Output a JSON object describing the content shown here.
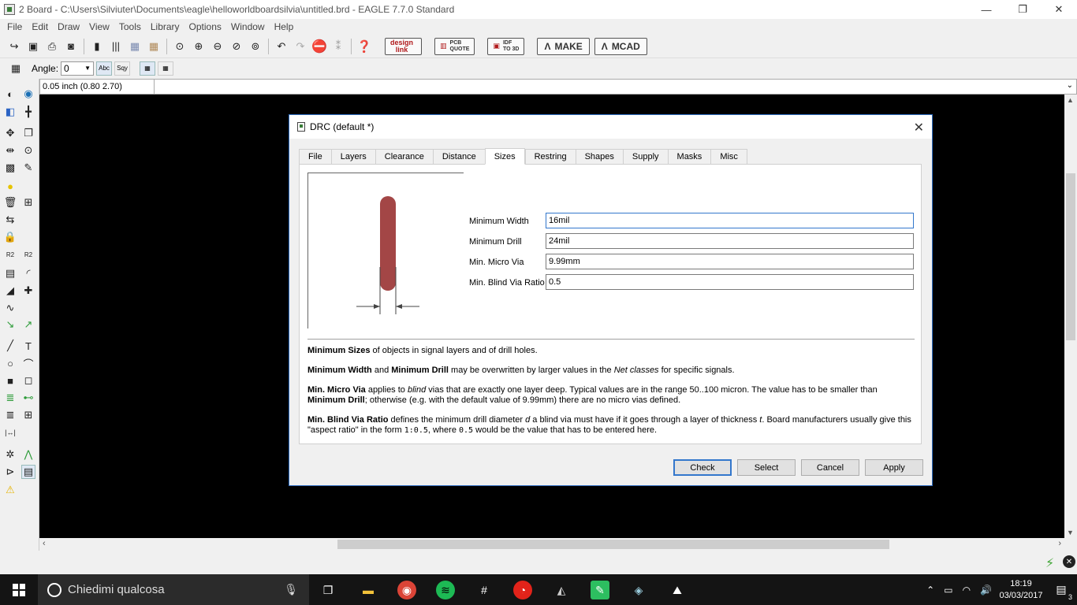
{
  "window": {
    "title": "2 Board - C:\\Users\\Silviuter\\Documents\\eagle\\helloworldboardsilvia\\untitled.brd - EAGLE 7.7.0 Standard",
    "minimize": "—",
    "restore": "❐",
    "close": "✕"
  },
  "menu": [
    "File",
    "Edit",
    "Draw",
    "View",
    "Tools",
    "Library",
    "Options",
    "Window",
    "Help"
  ],
  "toolbar": {
    "designlink_line1": "design",
    "designlink_line2": "link",
    "pcbquote_line1": "PCB",
    "pcbquote_line2": "QUOTE",
    "idf_line1": "IDF",
    "idf_line2": "TO 3D",
    "make_label": "MAKE",
    "mcad_label": "MCAD"
  },
  "toolbar2": {
    "angle_label": "Angle:",
    "angle_value": "0",
    "abc_label": "Abc",
    "sqy_label": "Sqy"
  },
  "command": {
    "coordinates": "0.05 inch (0.80 2.70)"
  },
  "dialog": {
    "title": "DRC (default *)",
    "tabs": [
      "File",
      "Layers",
      "Clearance",
      "Distance",
      "Sizes",
      "Restring",
      "Shapes",
      "Supply",
      "Masks",
      "Misc"
    ],
    "active_tab": "Sizes",
    "fields": {
      "min_width_label": "Minimum Width",
      "min_width_value": "16mil",
      "min_drill_label": "Minimum Drill",
      "min_drill_value": "24mil",
      "micro_via_label": "Min. Micro Via",
      "micro_via_value": "9.99mm",
      "blind_ratio_label": "Min. Blind Via Ratio",
      "blind_ratio_value": "0.5"
    },
    "desc": {
      "p1_b": "Minimum Sizes",
      "p1_t": " of objects in signal layers and of drill holes.",
      "p2_b1": "Minimum Width",
      "p2_t1": " and ",
      "p2_b2": "Minimum Drill",
      "p2_t2": " may be overwritten by larger values in the ",
      "p2_i": "Net classes",
      "p2_t3": " for specific signals.",
      "p3_b1": "Min. Micro Via",
      "p3_t1": " applies to ",
      "p3_i": "blind",
      "p3_t2": " vias that are exactly one layer deep. Typical values are in the range 50..100 micron. The value has to be smaller than ",
      "p3_b2": "Minimum Drill",
      "p3_t3": "; otherwise (e.g. with the default value of 9.99mm) there are no micro vias defined.",
      "p4_b": "Min. Blind Via Ratio",
      "p4_t1": " defines the minimum drill diameter ",
      "p4_i1": "d",
      "p4_t2": " a blind via must have if it goes through a layer of thickness ",
      "p4_i2": "t",
      "p4_t3": ". Board manufacturers usually give this \"aspect ratio\" in the form ",
      "p4_m1": "1:0.5",
      "p4_t4": ", where ",
      "p4_m2": "0.5",
      "p4_t5": " would be the value that has to be entered here."
    },
    "buttons": {
      "check": "Check",
      "select": "Select",
      "cancel": "Cancel",
      "apply": "Apply"
    }
  },
  "taskbar": {
    "search_placeholder": "Chiedimi qualcosa",
    "time": "18:19",
    "date": "03/03/2017",
    "notification_count": "3"
  },
  "colors": {
    "canvas": "#000000",
    "trace": "#a34646",
    "accent": "#3377cc",
    "taskbar": "#141414"
  }
}
